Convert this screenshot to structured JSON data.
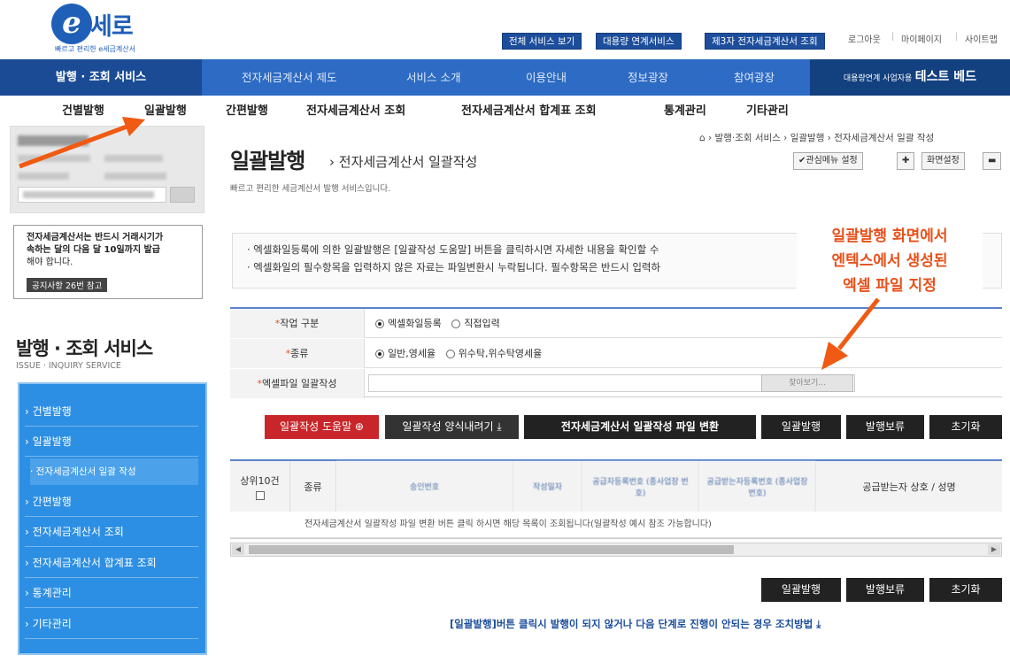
{
  "header": {
    "logo_mark": "e",
    "logo_name": "세로",
    "logo_sub": "빠르고 편리한 e세금계산서",
    "top_buttons": [
      "전체 서비스 보기",
      "대용량 연계서비스",
      "제3자 전자세금계산서 조회"
    ],
    "top_links": [
      "로그아웃",
      "마이페이지",
      "사이트맵"
    ]
  },
  "nav": {
    "items": [
      "발행 · 조회 서비스",
      "전자세금계산서 제도",
      "서비스 소개",
      "이용안내",
      "정보광장",
      "참여광장"
    ],
    "right_small": "대용량연계 사업자용",
    "right_big": "테스트 베드"
  },
  "subnav": [
    "건별발행",
    "일괄발행",
    "간편발행",
    "전자세금계산서 조회",
    "전자세금계산서 합계표 조회",
    "통계관리",
    "기타관리"
  ],
  "notice_box": {
    "line1": "전자세금계산서는 반드시 거래시기가",
    "line2": "속하는 달의 다음 달 10일까지 발급",
    "line3": "해야 합니다.",
    "button": "공지사항 26번 참고"
  },
  "sidebar": {
    "title": "발행 · 조회 서비스",
    "subtitle": "ISSUE · INQUIRY SERVICE",
    "items": [
      "› 건별발행",
      "› 일괄발행",
      "· 전자세금계산서 일괄 작성",
      "› 간편발행",
      "› 전자세금계산서 조회",
      "› 전자세금계산서 합계표 조회",
      "› 통계관리",
      "› 기타관리"
    ]
  },
  "main": {
    "breadcrumb": "⌂ › 발행·조회 서비스 › 일괄발행 › 전자세금계산서 일괄 작성",
    "title": "일괄발행",
    "title_sub": "› 전자세금계산서 일괄작성",
    "desc": "빠르고 편리한 세금계산서 발행 서비스입니다.",
    "btn_fav": "✔관심메뉴 설정",
    "btn_plus": "✚",
    "btn_screen": "화면설정",
    "btn_minus": "▬",
    "notice_line1": "· 엑셀화일등록에 의한 일괄발행은 [일괄작성 도움말] 버튼을 클릭하시면 자세한 내용을 확인할 수",
    "notice_line2": "· 엑셀화일의 필수항목을 입력하지 않은 자료는 파일변환시 누락됩니다. 필수항목은 반드시 입력하",
    "callout_1": "일괄발행 화면에서",
    "callout_2": "엔텍스에서 생성된",
    "callout_3": "엑셀 파일 지정"
  },
  "form": {
    "label_work": "작업 구분",
    "work_opt1": "엑셀화일등록",
    "work_opt2": "직접입력",
    "label_type": "종류",
    "type_opt1": "일반,영세율",
    "type_opt2": "위수탁,위수탁영세율",
    "label_file": "엑셀파일 일괄작성",
    "file_button": "찾아보기..."
  },
  "actions": {
    "help": "일괄작성 도움말 ⊕",
    "download": "일괄작성 양식내려기 ⤓",
    "convert": "전자세금계산서 일괄작성 파일 변환",
    "issue": "일괄발행",
    "hold": "발행보류",
    "reset": "초기화"
  },
  "grid": {
    "col_top10": "상위10건",
    "col_kind": "종류",
    "col_a": "승인번호",
    "col_b": "작성일자",
    "col_c": "공급자등록번호 (종사업장 번호)",
    "col_d": "공급받는자등록번호 (종사업장 번호)",
    "col_e": "공급받는자 상호 / 성명",
    "row_text": "전자세금계산서 일괄작성 파일 변환 버튼 클릭 하시면 해당 목록이 조회됩니다(일괄작성 예시 참조 가능합니다)"
  },
  "bottom_actions": {
    "issue": "일괄발행",
    "hold": "발행보류",
    "reset": "초기화"
  },
  "bottom_link": "[일괄발행]버튼 클릭시 발행이 되지 않거나 다음 단계로 진행이 안되는 경우 조치방법 ⤓",
  "colors": {
    "nav": "#2d6bc4",
    "nav_dark": "#1a4b94",
    "sidebar": "#2d8fe3",
    "accent": "#e8501a",
    "help_btn": "#c8262a"
  }
}
